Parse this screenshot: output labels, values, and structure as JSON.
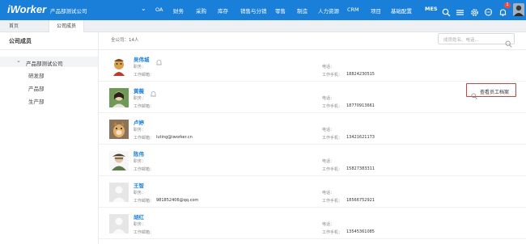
{
  "app": {
    "logo": "iWorker",
    "company": "产品部测试公司"
  },
  "nav": {
    "items": [
      "OA",
      "财务",
      "采购",
      "库存",
      "销售与分销",
      "零售",
      "制造",
      "人力资源",
      "CRM",
      "项目",
      "基础配置"
    ],
    "mes": "MES",
    "notification_count": "1"
  },
  "tabs": {
    "home": "首页",
    "active": "公司成员"
  },
  "sidebar": {
    "title": "公司成员",
    "root": "产品部测试公司",
    "children": [
      "研发部",
      "产品部",
      "生产部"
    ]
  },
  "main": {
    "count": "全公司：14人",
    "search_placeholder": "成员姓名、电话...",
    "archive_button": "查看员工档案",
    "labels": {
      "position": "职务：",
      "work_email": "工作邮箱：",
      "phone": "电话：",
      "work_mobile": "工作手机："
    },
    "members": [
      {
        "name": "吴伟城",
        "email": "",
        "mobile": "18824230515"
      },
      {
        "name": "黄薇",
        "email": "",
        "mobile": "18770913661"
      },
      {
        "name": "卢婷",
        "email": "luting@iworker.cn",
        "mobile": "13421621173"
      },
      {
        "name": "陈伟",
        "email": "",
        "mobile": "15827383311"
      },
      {
        "name": "王智",
        "email": "981852406@qq.com",
        "mobile": "18566752921"
      },
      {
        "name": "胡红",
        "email": "",
        "mobile": "13545361085"
      }
    ]
  }
}
